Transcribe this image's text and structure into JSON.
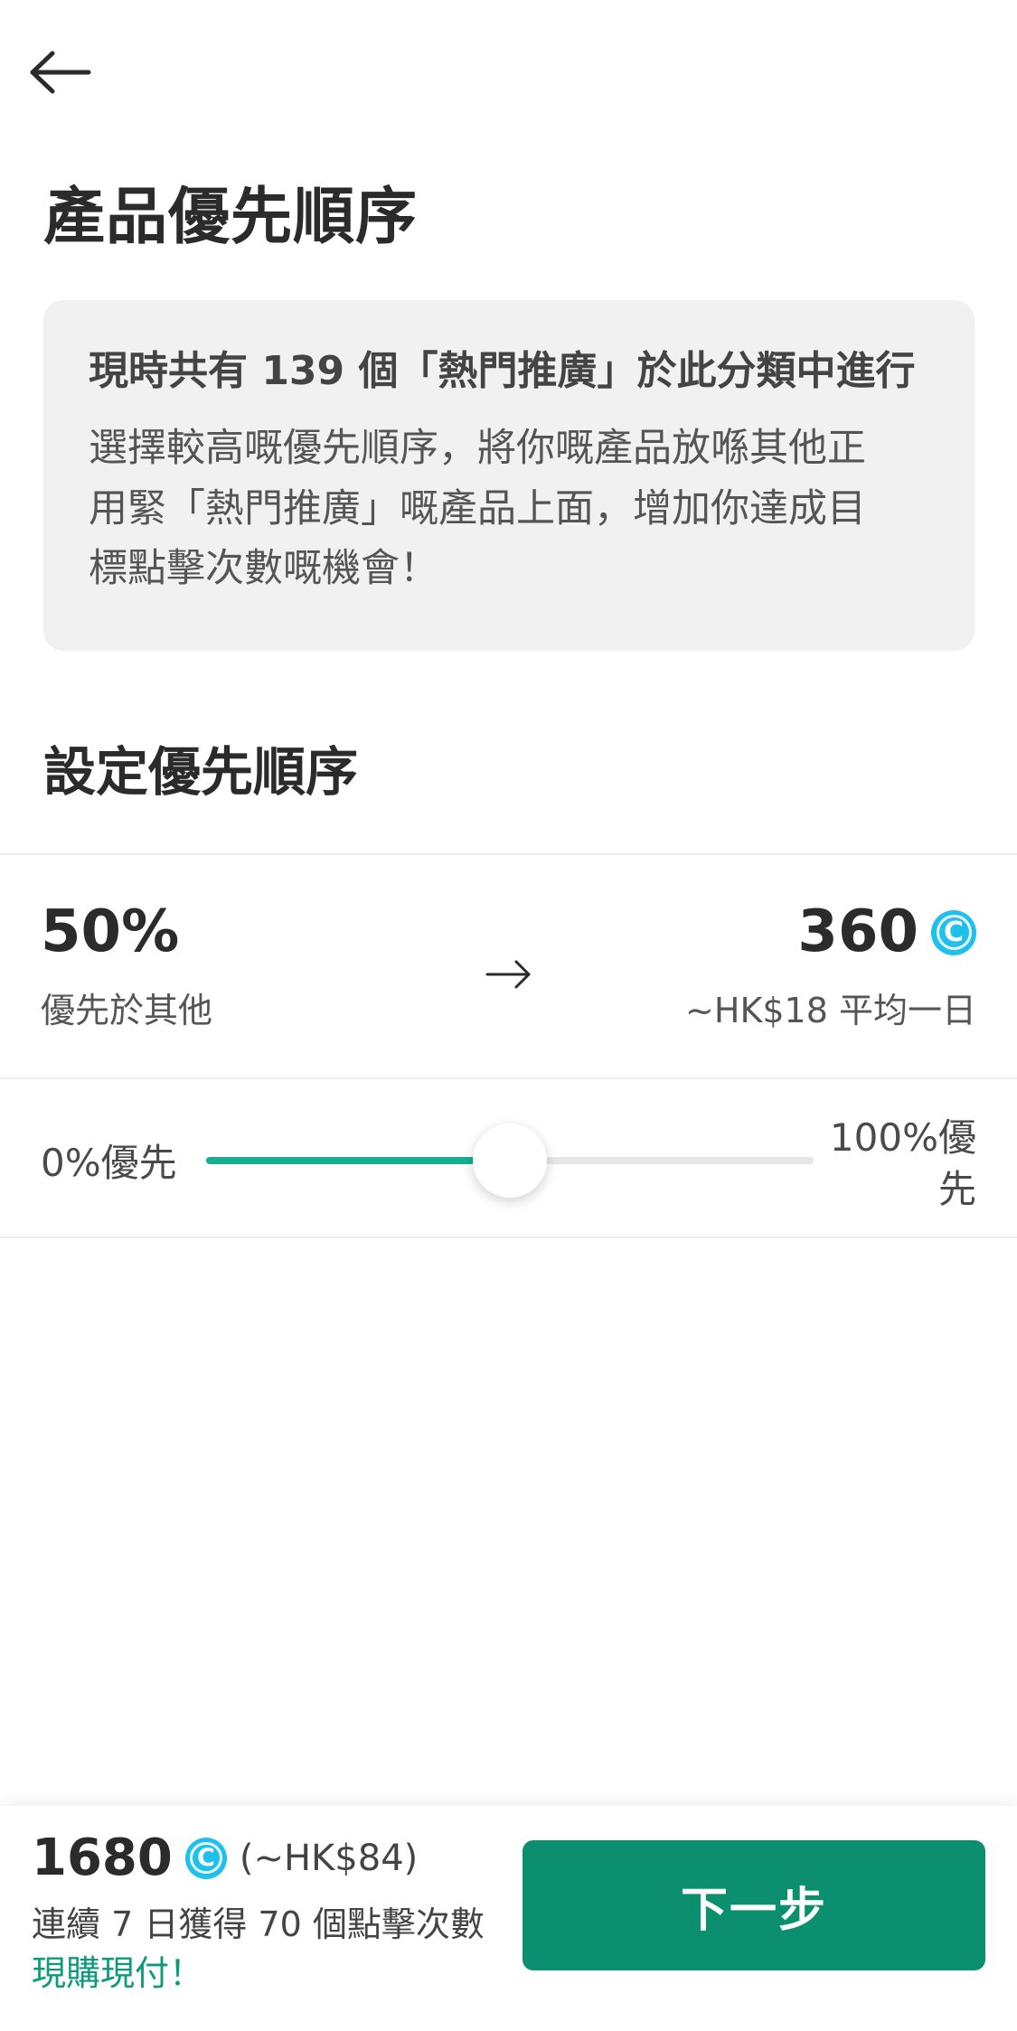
{
  "header": {
    "back_icon": "arrow-left-icon",
    "title": "產品優先順序"
  },
  "info_card": {
    "headline": "現時共有 139 個「熱門推廣」於此分類中進行",
    "description_lines": [
      "選擇較高嘅優先順序，將你嘅產品放喺其他正",
      "用緊「熱門推廣」嘅產品上面，增加你達成目",
      "標點擊次數嘅機會！"
    ]
  },
  "priority": {
    "section_title": "設定優先順序",
    "percent_value": "50%",
    "percent_caption": "優先於其他",
    "arrow_icon": "arrow-right-icon",
    "coins_value": "360",
    "coin_icon": "coin-icon",
    "coin_symbol": "C",
    "coins_caption": "~HK$18 平均一日"
  },
  "slider": {
    "min_label": "0%優先",
    "max_label": "100%優先",
    "value_percent": 50,
    "fill_color": "#14b08f"
  },
  "bottom_bar": {
    "amount": "1680",
    "amount_hkd": "(~HK$84)",
    "description": "連續 7 日獲得 70 個點擊次數",
    "promo": "現購現付！",
    "next_label": "下一步",
    "button_color": "#0b8f6f"
  }
}
